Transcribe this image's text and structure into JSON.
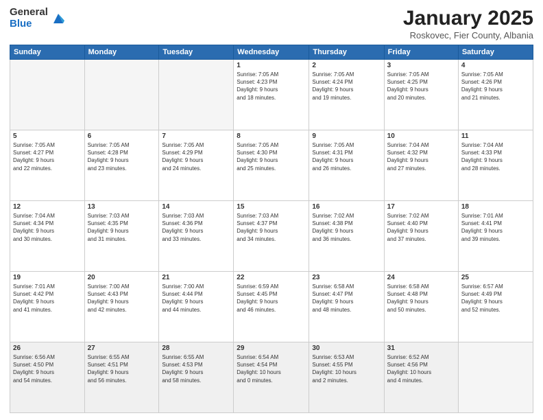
{
  "logo": {
    "general": "General",
    "blue": "Blue"
  },
  "header": {
    "month": "January 2025",
    "location": "Roskovec, Fier County, Albania"
  },
  "weekdays": [
    "Sunday",
    "Monday",
    "Tuesday",
    "Wednesday",
    "Thursday",
    "Friday",
    "Saturday"
  ],
  "weeks": [
    [
      {
        "day": "",
        "info": ""
      },
      {
        "day": "",
        "info": ""
      },
      {
        "day": "",
        "info": ""
      },
      {
        "day": "1",
        "info": "Sunrise: 7:05 AM\nSunset: 4:23 PM\nDaylight: 9 hours\nand 18 minutes."
      },
      {
        "day": "2",
        "info": "Sunrise: 7:05 AM\nSunset: 4:24 PM\nDaylight: 9 hours\nand 19 minutes."
      },
      {
        "day": "3",
        "info": "Sunrise: 7:05 AM\nSunset: 4:25 PM\nDaylight: 9 hours\nand 20 minutes."
      },
      {
        "day": "4",
        "info": "Sunrise: 7:05 AM\nSunset: 4:26 PM\nDaylight: 9 hours\nand 21 minutes."
      }
    ],
    [
      {
        "day": "5",
        "info": "Sunrise: 7:05 AM\nSunset: 4:27 PM\nDaylight: 9 hours\nand 22 minutes."
      },
      {
        "day": "6",
        "info": "Sunrise: 7:05 AM\nSunset: 4:28 PM\nDaylight: 9 hours\nand 23 minutes."
      },
      {
        "day": "7",
        "info": "Sunrise: 7:05 AM\nSunset: 4:29 PM\nDaylight: 9 hours\nand 24 minutes."
      },
      {
        "day": "8",
        "info": "Sunrise: 7:05 AM\nSunset: 4:30 PM\nDaylight: 9 hours\nand 25 minutes."
      },
      {
        "day": "9",
        "info": "Sunrise: 7:05 AM\nSunset: 4:31 PM\nDaylight: 9 hours\nand 26 minutes."
      },
      {
        "day": "10",
        "info": "Sunrise: 7:04 AM\nSunset: 4:32 PM\nDaylight: 9 hours\nand 27 minutes."
      },
      {
        "day": "11",
        "info": "Sunrise: 7:04 AM\nSunset: 4:33 PM\nDaylight: 9 hours\nand 28 minutes."
      }
    ],
    [
      {
        "day": "12",
        "info": "Sunrise: 7:04 AM\nSunset: 4:34 PM\nDaylight: 9 hours\nand 30 minutes."
      },
      {
        "day": "13",
        "info": "Sunrise: 7:03 AM\nSunset: 4:35 PM\nDaylight: 9 hours\nand 31 minutes."
      },
      {
        "day": "14",
        "info": "Sunrise: 7:03 AM\nSunset: 4:36 PM\nDaylight: 9 hours\nand 33 minutes."
      },
      {
        "day": "15",
        "info": "Sunrise: 7:03 AM\nSunset: 4:37 PM\nDaylight: 9 hours\nand 34 minutes."
      },
      {
        "day": "16",
        "info": "Sunrise: 7:02 AM\nSunset: 4:38 PM\nDaylight: 9 hours\nand 36 minutes."
      },
      {
        "day": "17",
        "info": "Sunrise: 7:02 AM\nSunset: 4:40 PM\nDaylight: 9 hours\nand 37 minutes."
      },
      {
        "day": "18",
        "info": "Sunrise: 7:01 AM\nSunset: 4:41 PM\nDaylight: 9 hours\nand 39 minutes."
      }
    ],
    [
      {
        "day": "19",
        "info": "Sunrise: 7:01 AM\nSunset: 4:42 PM\nDaylight: 9 hours\nand 41 minutes."
      },
      {
        "day": "20",
        "info": "Sunrise: 7:00 AM\nSunset: 4:43 PM\nDaylight: 9 hours\nand 42 minutes."
      },
      {
        "day": "21",
        "info": "Sunrise: 7:00 AM\nSunset: 4:44 PM\nDaylight: 9 hours\nand 44 minutes."
      },
      {
        "day": "22",
        "info": "Sunrise: 6:59 AM\nSunset: 4:45 PM\nDaylight: 9 hours\nand 46 minutes."
      },
      {
        "day": "23",
        "info": "Sunrise: 6:58 AM\nSunset: 4:47 PM\nDaylight: 9 hours\nand 48 minutes."
      },
      {
        "day": "24",
        "info": "Sunrise: 6:58 AM\nSunset: 4:48 PM\nDaylight: 9 hours\nand 50 minutes."
      },
      {
        "day": "25",
        "info": "Sunrise: 6:57 AM\nSunset: 4:49 PM\nDaylight: 9 hours\nand 52 minutes."
      }
    ],
    [
      {
        "day": "26",
        "info": "Sunrise: 6:56 AM\nSunset: 4:50 PM\nDaylight: 9 hours\nand 54 minutes."
      },
      {
        "day": "27",
        "info": "Sunrise: 6:55 AM\nSunset: 4:51 PM\nDaylight: 9 hours\nand 56 minutes."
      },
      {
        "day": "28",
        "info": "Sunrise: 6:55 AM\nSunset: 4:53 PM\nDaylight: 9 hours\nand 58 minutes."
      },
      {
        "day": "29",
        "info": "Sunrise: 6:54 AM\nSunset: 4:54 PM\nDaylight: 10 hours\nand 0 minutes."
      },
      {
        "day": "30",
        "info": "Sunrise: 6:53 AM\nSunset: 4:55 PM\nDaylight: 10 hours\nand 2 minutes."
      },
      {
        "day": "31",
        "info": "Sunrise: 6:52 AM\nSunset: 4:56 PM\nDaylight: 10 hours\nand 4 minutes."
      },
      {
        "day": "",
        "info": ""
      }
    ]
  ]
}
